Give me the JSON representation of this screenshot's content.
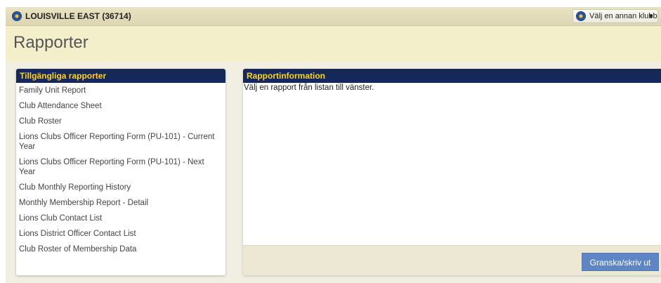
{
  "club": {
    "name": "LOUISVILLE EAST (36714)",
    "logo_icon": "lions-logo-icon",
    "switch_label": "Välj en annan klubb",
    "switch_caret": "▼"
  },
  "page": {
    "title": "Rapporter"
  },
  "reports_panel": {
    "header": "Tillgängliga rapporter",
    "items": [
      "Family Unit Report",
      "Club Attendance Sheet",
      "Club Roster",
      "Lions Clubs Officer Reporting Form (PU-101) - Current Year",
      "Lions Clubs Officer Reporting Form (PU-101) - Next Year",
      "Club Monthly Reporting History",
      "Monthly Membership Report - Detail",
      "Lions Club Contact List",
      "Lions District Officer Contact List",
      "Club Roster of Membership Data"
    ]
  },
  "info_panel": {
    "header": "Rapportinformation",
    "message": "Välj en rapport från listan till vänster.",
    "print_button": "Granska/skriv ut"
  },
  "colors": {
    "header_bg": "#16285a",
    "header_text": "#ffd21f",
    "button_bg": "#5e86c4",
    "page_bg": "#f3efca"
  }
}
